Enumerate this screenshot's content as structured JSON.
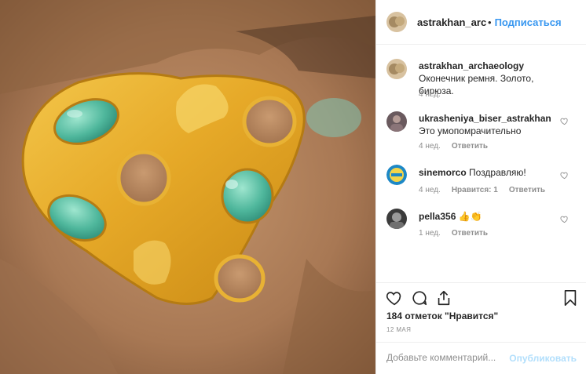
{
  "post": {
    "author": "astrakhan_archaeology",
    "author_short": "astrakhan_archa",
    "dot": "•",
    "follow_label": "Подписаться",
    "photo_description_icon": "gold-artifact-photo"
  },
  "caption": {
    "username": "astrakhan_archaeology",
    "text": "Оконечник ремня. Золото, бирюза.",
    "time": "4 нед."
  },
  "comments": [
    {
      "username": "ukrasheniya_biser_astrakhan",
      "text": "Это умопомрачительно",
      "time": "4 нед.",
      "likes": "",
      "reply": "Ответить"
    },
    {
      "username": "sinemorco",
      "text": "Поздравляю!",
      "time": "4 нед.",
      "likes": "Нравится: 1",
      "reply": "Ответить"
    },
    {
      "username": "pella356",
      "text": "👍👏",
      "time": "1 нед.",
      "likes": "",
      "reply": "Ответить"
    }
  ],
  "likes_text": "184 отметок \"Нравится\"",
  "date_text": "12 МАЯ",
  "add_comment": {
    "placeholder": "Добавьте комментарий...",
    "publish_label": "Опубликовать"
  },
  "colors": {
    "link": "#3897f0",
    "muted": "#8e8e8e",
    "publish_disabled": "#b2dffc"
  }
}
